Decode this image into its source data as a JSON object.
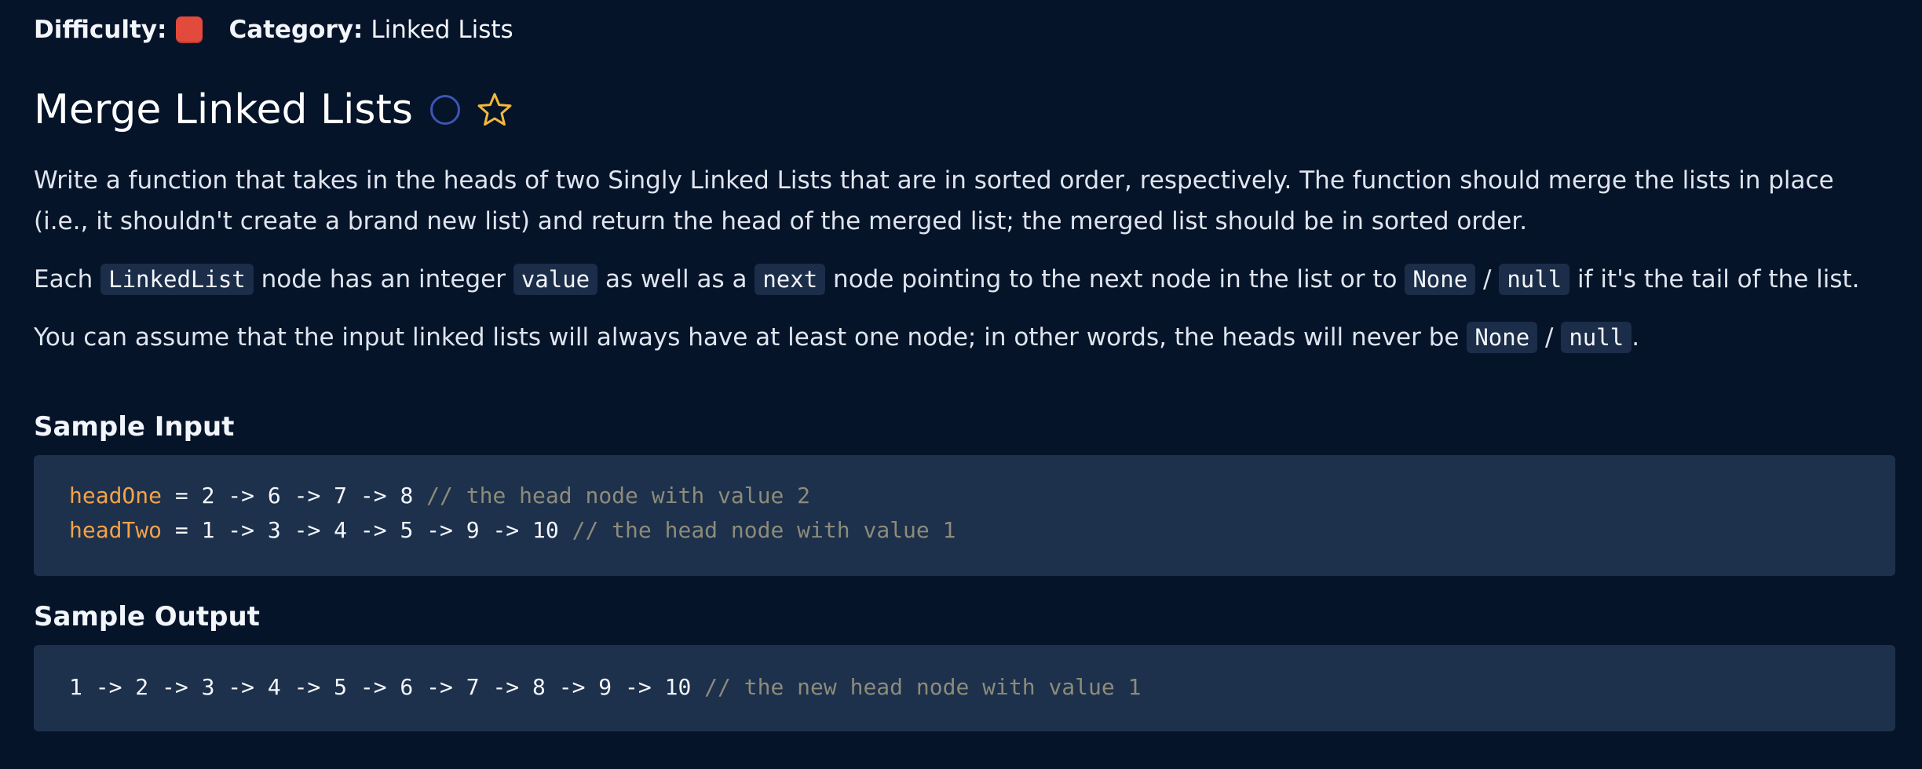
{
  "meta": {
    "difficulty_label": "Difficulty:",
    "difficulty_color": "#e24a3b",
    "category_label": "Category:",
    "category_value": "Linked Lists"
  },
  "header": {
    "title": "Merge Linked Lists",
    "status_icon": "circle-icon",
    "favorite_icon": "star-icon",
    "favorite_color": "#f0b93a"
  },
  "description": {
    "p1": "Write a function that takes in the heads of two Singly Linked Lists that are in sorted order, respectively. The function should merge the lists in place (i.e., it shouldn't create a brand new list) and return the head of the merged list; the merged list should be in sorted order.",
    "p2": {
      "t1": "Each ",
      "c1": "LinkedList",
      "t2": " node has an integer ",
      "c2": "value",
      "t3": " as well as a ",
      "c3": "next",
      "t4": " node pointing to the next node in the list or to ",
      "c4": "None",
      "t5": " / ",
      "c5": "null",
      "t6": " if it's the tail of the list."
    },
    "p3": {
      "t1": "You can assume that the input linked lists will always have at least one node; in other words, the heads will never be ",
      "c1": "None",
      "t2": " / ",
      "c2": "null",
      "t3": "."
    }
  },
  "sample_input": {
    "heading": "Sample Input",
    "lines": [
      {
        "var": "headOne",
        "expr": " = 2 -> 6 -> 7 -> 8 ",
        "comment": "// the head node with value 2"
      },
      {
        "var": "headTwo",
        "expr": " = 1 -> 3 -> 4 -> 5 -> 9 -> 10 ",
        "comment": "// the head node with value 1"
      }
    ]
  },
  "sample_output": {
    "heading": "Sample Output",
    "expr": "1 -> 2 -> 3 -> 4 -> 5 -> 6 -> 7 -> 8 -> 9 -> 10 ",
    "comment": "// the new head node with value 1"
  }
}
